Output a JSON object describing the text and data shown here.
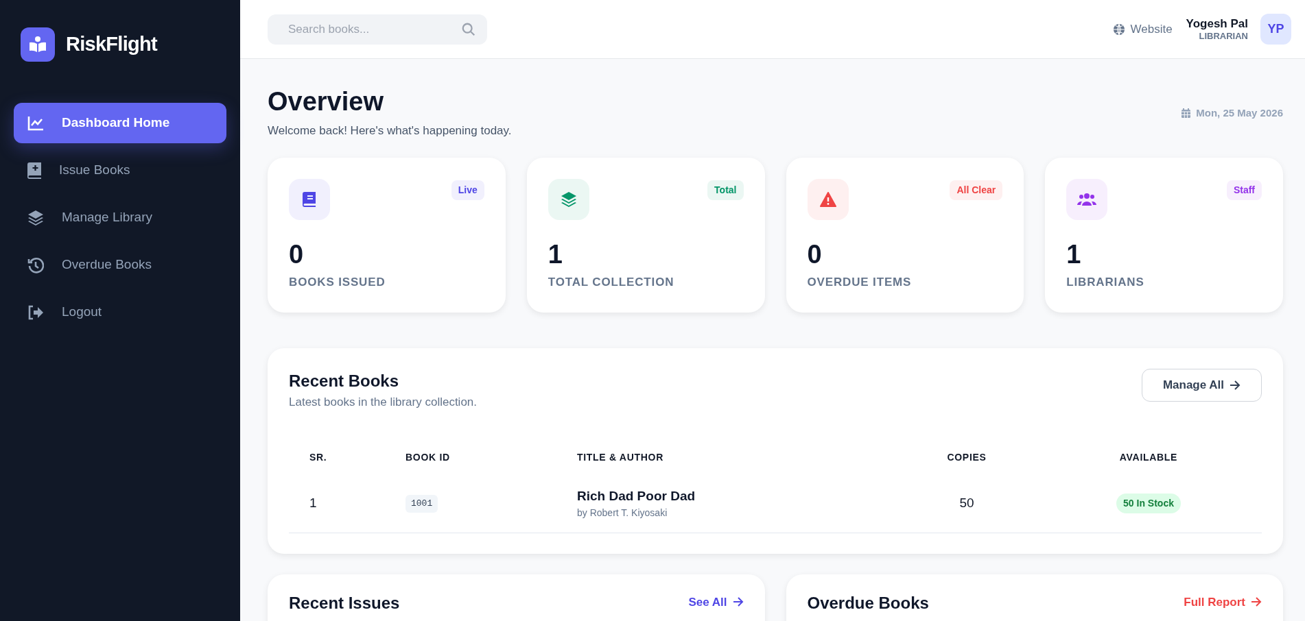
{
  "brand": {
    "name": "RiskFlight"
  },
  "sidebar": {
    "items": [
      {
        "label": "Dashboard Home",
        "selected": true
      },
      {
        "label": "Issue Books",
        "selected": false
      },
      {
        "label": "Manage Library",
        "selected": false
      },
      {
        "label": "Overdue Books",
        "selected": false
      },
      {
        "label": "Logout",
        "selected": false
      }
    ]
  },
  "header": {
    "search": {
      "placeholder": "Search books..."
    },
    "website_link": "Website",
    "user": {
      "name": "Yogesh Pal",
      "role": "LIBRARIAN",
      "initials": "YP"
    }
  },
  "page": {
    "title": "Overview",
    "subtitle": "Welcome back! Here's what's happening today.",
    "date": "Mon, 25 May 2026"
  },
  "stats": [
    {
      "value": "0",
      "label": "BOOKS ISSUED",
      "badge": "Live",
      "color": "#4f46e5"
    },
    {
      "value": "1",
      "label": "TOTAL COLLECTION",
      "badge": "Total",
      "color": "#059669"
    },
    {
      "value": "0",
      "label": "OVERDUE ITEMS",
      "badge": "All Clear",
      "color": "#ef4444"
    },
    {
      "value": "1",
      "label": "LIBRARIANS",
      "badge": "Staff",
      "color": "#9333ea"
    }
  ],
  "recent_books": {
    "title": "Recent Books",
    "subtitle": "Latest books in the library collection.",
    "action": "Manage All",
    "columns": [
      "SR.",
      "BOOK ID",
      "TITLE & AUTHOR",
      "COPIES",
      "AVAILABLE"
    ],
    "rows": [
      {
        "sr": "1",
        "book_id": "1001",
        "title": "Rich Dad Poor Dad",
        "author": "by Robert T. Kiyosaki",
        "copies": "50",
        "available": "50 In Stock"
      }
    ]
  },
  "panels": [
    {
      "title": "Recent Issues",
      "link": "See All",
      "color": "#4f46e5"
    },
    {
      "title": "Overdue Books",
      "link": "Full Report",
      "color": "#ef4444"
    }
  ]
}
